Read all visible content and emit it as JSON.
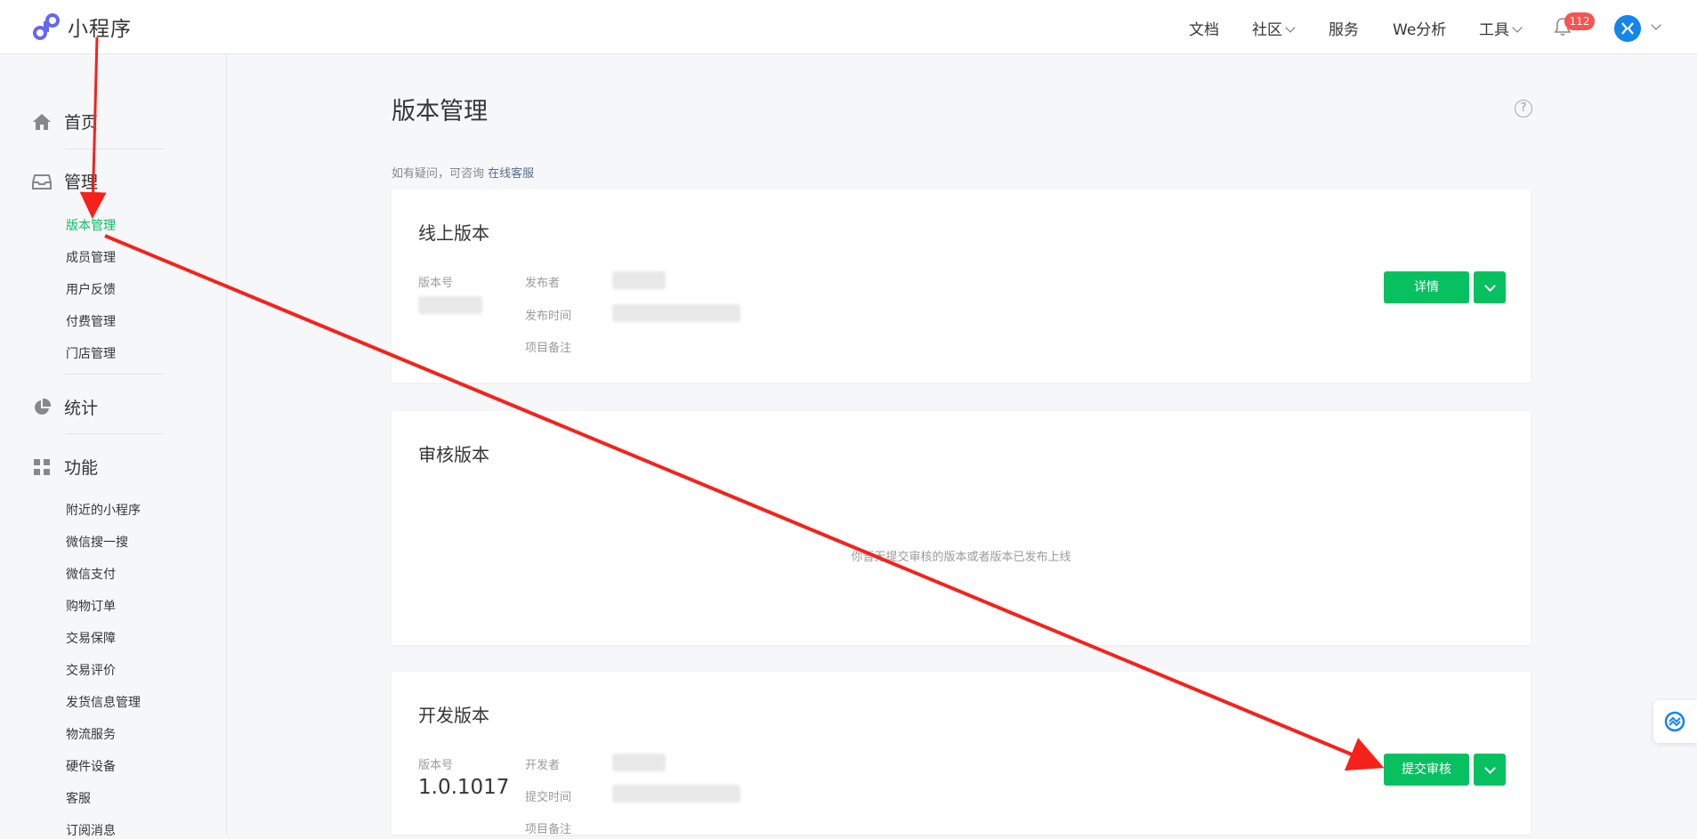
{
  "header": {
    "app_name": "小程序",
    "nav": [
      {
        "label": "文档",
        "has_dropdown": false
      },
      {
        "label": "社区",
        "has_dropdown": true
      },
      {
        "label": "服务",
        "has_dropdown": false
      },
      {
        "label": "We分析",
        "has_dropdown": false
      },
      {
        "label": "工具",
        "has_dropdown": true
      }
    ],
    "notification_count": "112",
    "avatar_icon": "user-avatar-icon"
  },
  "sidebar": {
    "sections": [
      {
        "label": "首页",
        "icon": "home-icon"
      },
      {
        "label": "管理",
        "icon": "inbox-icon"
      },
      {
        "label": "统计",
        "icon": "pie-chart-icon"
      },
      {
        "label": "功能",
        "icon": "grid-icon"
      }
    ],
    "manage_items": [
      "版本管理",
      "成员管理",
      "用户反馈",
      "付费管理",
      "门店管理"
    ],
    "feature_items": [
      "附近的小程序",
      "微信搜一搜",
      "微信支付",
      "购物订单",
      "交易保障",
      "交易评价",
      "发货信息管理",
      "物流服务",
      "硬件设备",
      "客服",
      "订阅消息"
    ],
    "active_item": "版本管理"
  },
  "main": {
    "title": "版本管理",
    "tip_text": "如有疑问，可咨询",
    "tip_link": "在线客服",
    "online": {
      "title": "线上版本",
      "version_label": "版本号",
      "publisher_label": "发布者",
      "publish_time_label": "发布时间",
      "remark_label": "项目备注",
      "details_button": "详情"
    },
    "review": {
      "title": "审核版本",
      "empty_text": "你暂无提交审核的版本或者版本已发布上线"
    },
    "dev": {
      "title": "开发版本",
      "version_label": "版本号",
      "version": "1.0.1017",
      "developer_label": "开发者",
      "submit_time_label": "提交时间",
      "remark_label": "项目备注",
      "submit_button": "提交审核"
    }
  },
  "colors": {
    "accent_green": "#07c160",
    "annotation_red": "#f5221b",
    "badge_red": "#fa5151",
    "link_blue": "#576b95"
  }
}
